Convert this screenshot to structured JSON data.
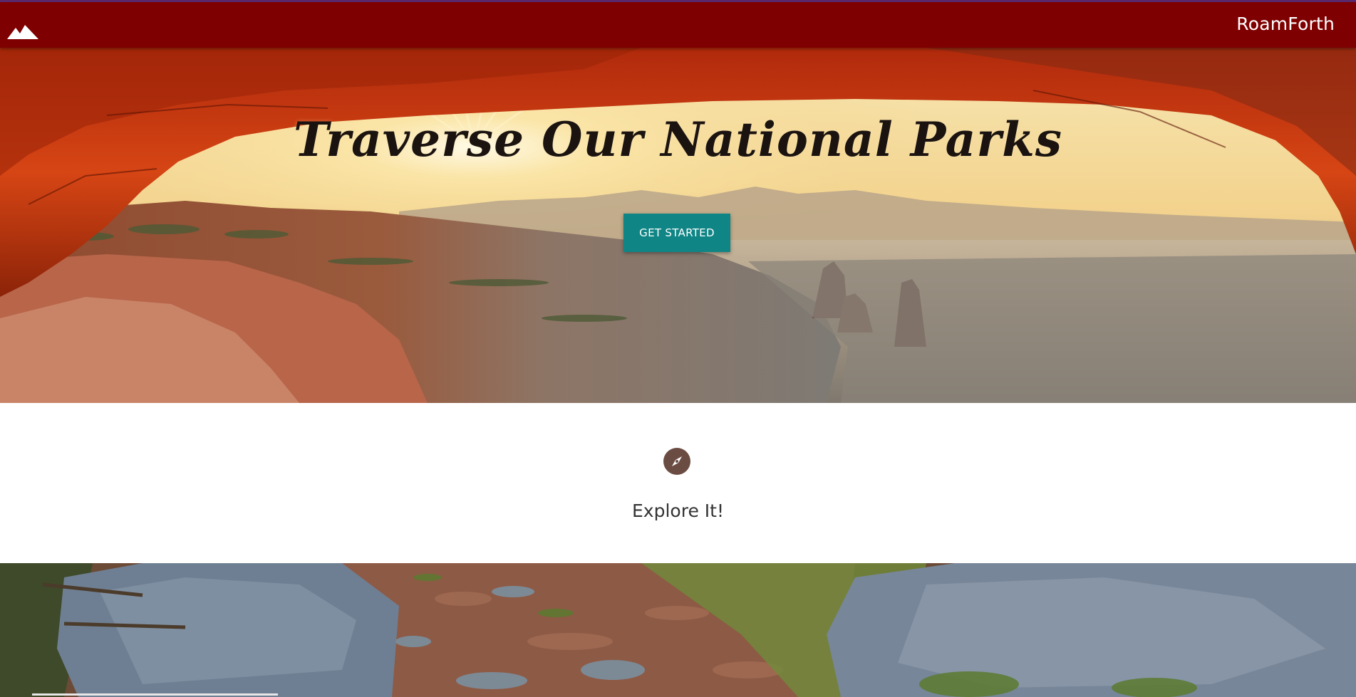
{
  "navbar": {
    "brand": "RoamForth",
    "logo_icon": "mountain-icon",
    "background": "#7f0000"
  },
  "hero": {
    "title": "Traverse Our National Parks",
    "cta_label": "GET STARTED",
    "cta_color": "#0f8585"
  },
  "feature": {
    "icon": "compass-icon",
    "label": "Explore It!",
    "icon_color": "#6b4c43"
  }
}
